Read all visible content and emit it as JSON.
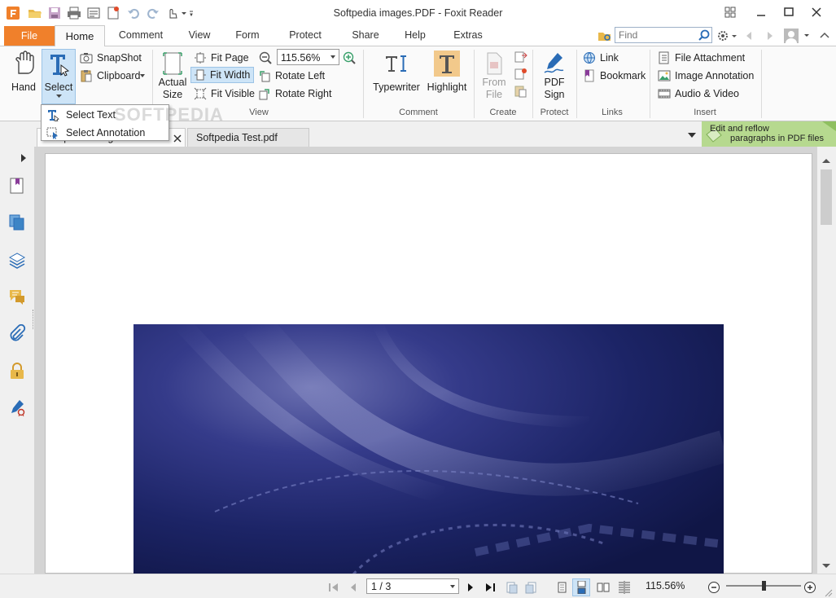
{
  "window": {
    "title": "Softpedia images.PDF - Foxit Reader"
  },
  "ribbon_tabs": {
    "file": "File",
    "home": "Home",
    "comment": "Comment",
    "view": "View",
    "form": "Form",
    "protect": "Protect",
    "share": "Share",
    "help": "Help",
    "extras": "Extras"
  },
  "search": {
    "placeholder": "Find"
  },
  "home": {
    "hand": "Hand",
    "select": "Select",
    "snapshot": "SnapShot",
    "clipboard": "Clipboard",
    "actual_size": [
      "Actual",
      "Size"
    ],
    "fit_page": "Fit Page",
    "fit_width": "Fit Width",
    "fit_visible": "Fit Visible",
    "zoom_value": "115.56%",
    "rotate_left": "Rotate Left",
    "rotate_right": "Rotate Right",
    "typewriter": "Typewriter",
    "highlight": "Highlight",
    "from_file": [
      "From",
      "File"
    ],
    "pdf_sign": [
      "PDF",
      "Sign"
    ],
    "link": "Link",
    "bookmark": "Bookmark",
    "file_attachment": "File Attachment",
    "image_annotation": "Image Annotation",
    "audio_video": "Audio & Video",
    "groups": {
      "view": "View",
      "comment": "Comment",
      "create": "Create",
      "protect": "Protect",
      "links": "Links",
      "insert": "Insert"
    }
  },
  "select_menu": {
    "select_text": "Select Text",
    "select_annotation": "Select Annotation"
  },
  "document_tabs": [
    {
      "label": "Softpedia images.PDF",
      "active": true
    },
    {
      "label": "Softpedia Test.pdf",
      "active": false
    }
  ],
  "promo": {
    "line1": "Edit and reflow",
    "line2": "paragraphs in PDF files"
  },
  "watermark": "SOFTPEDIA",
  "statusbar": {
    "page_indicator": "1 / 3",
    "zoom": "115.56%"
  },
  "colors": {
    "accent_orange": "#f0802b",
    "selection_blue": "#cde4f7",
    "promo_green": "#b6d98f",
    "icon_blue": "#2a6cb6"
  }
}
